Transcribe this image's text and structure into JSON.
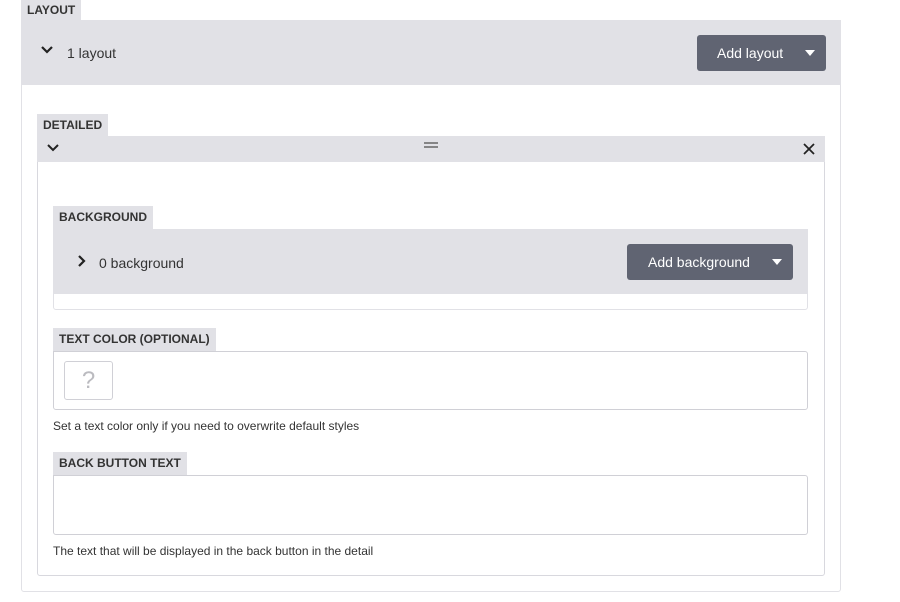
{
  "layout": {
    "tag": "LAYOUT",
    "summary": "1 layout",
    "add_button": "Add layout",
    "item": {
      "tag": "DETAILED",
      "background": {
        "tag": "BACKGROUND",
        "summary": "0 background",
        "add_button": "Add background"
      },
      "text_color": {
        "tag": "TEXT COLOR (OPTIONAL)",
        "swatch_glyph": "?",
        "help": "Set a text color only if you need to overwrite default styles"
      },
      "back_button_text": {
        "tag": "BACK BUTTON TEXT",
        "value": "",
        "help": "The text that will be displayed in the back button in the detail"
      }
    }
  },
  "icons": {
    "chevron_down": "chevron-down-icon",
    "chevron_right": "chevron-right-icon",
    "drag_handle": "drag-handle-icon",
    "close": "close-icon",
    "caret_down": "caret-down-icon",
    "color_unknown": "question-icon"
  },
  "colors": {
    "header_bg": "#e1e1e6",
    "button_bg": "#606472",
    "border": "#d0d0d6"
  }
}
